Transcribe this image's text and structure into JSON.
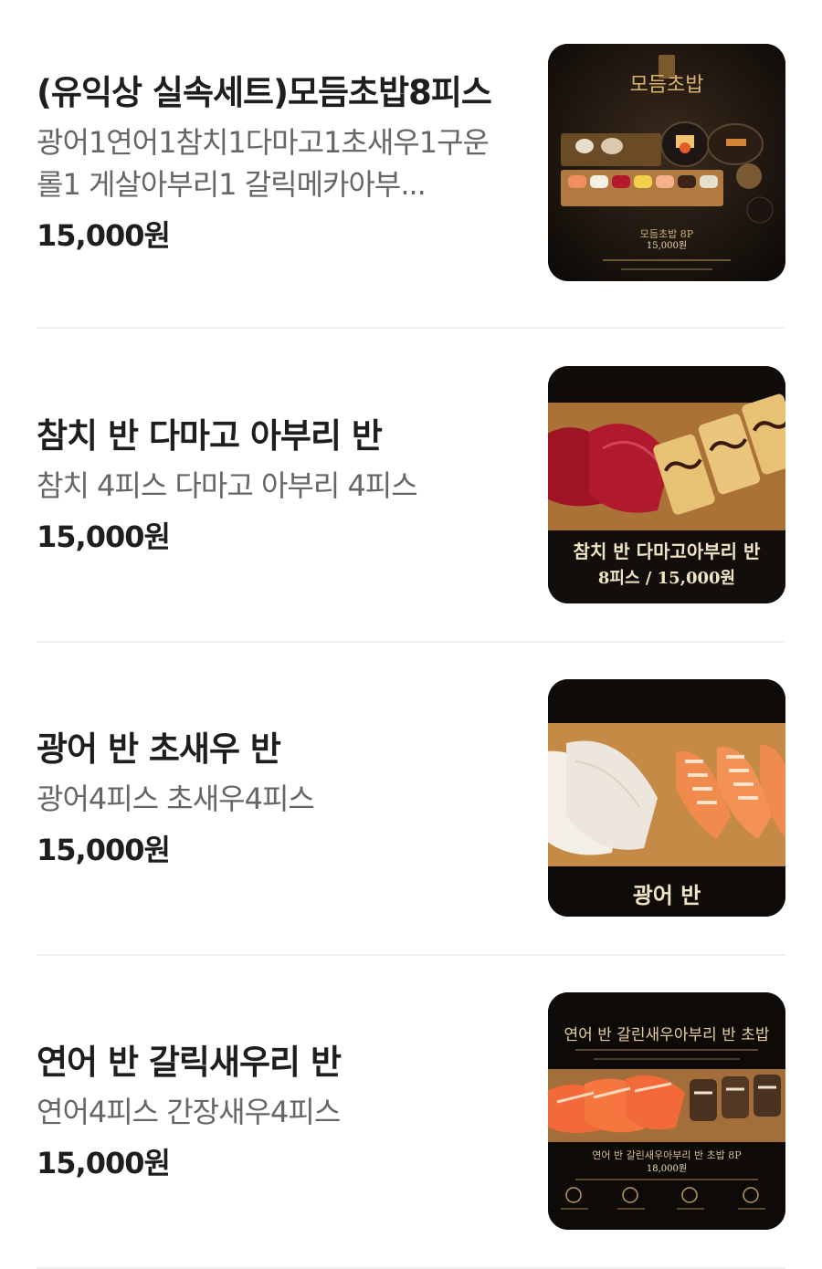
{
  "menu": {
    "items": [
      {
        "title": "(유익상 실속세트)모듬초밥8피스",
        "description": "광어1연어1참치1다마고1초새우1구운롤1 게살아부리1 갈릭메카아부...",
        "price": "15,000원",
        "image": {
          "header": "모듬초밥",
          "caption": "모듬초밥 8P",
          "price": "15,000원"
        }
      },
      {
        "title": "참치 반 다마고 아부리 반",
        "description": "참치 4피스 다마고 아부리 4피스",
        "price": "15,000원",
        "image": {
          "caption_line1": "참치 반 다마고아부리 반",
          "caption_line2": "8피스 / 15,000원"
        }
      },
      {
        "title": "광어 반 초새우 반",
        "description": "광어4피스 초새우4피스",
        "price": "15,000원",
        "image": {
          "caption": "광어 반"
        }
      },
      {
        "title": "연어 반 갈릭새우리 반",
        "description": "연어4피스 간장새우4피스",
        "price": "15,000원",
        "image": {
          "header": "연어 반 갈린새우아부리 반 초밥",
          "caption": "연어 반 갈린새우아부리 반 초밥 8P",
          "price": "18,000원"
        }
      }
    ]
  }
}
